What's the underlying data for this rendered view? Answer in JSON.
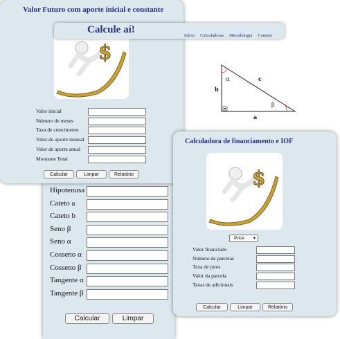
{
  "trig_panel": {
    "labels": [
      "Hipotenusa",
      "Cateto a",
      "Cateto b",
      "Seno β",
      "Seno α",
      "Cosseno α",
      "Cosseno β",
      "Tangente α",
      "Tangente β"
    ],
    "calc_button": "Calcular",
    "clear_button": "Limpar"
  },
  "future_panel": {
    "title": "Valor Futuro com aporte inicial e constante",
    "fields": [
      "Valor inicial",
      "Número de meses",
      "Taxa de crescimento",
      "Valor do aporte mensal",
      "Valor de aporte anual",
      "Montante Total"
    ],
    "calc_button": "Calcular",
    "clear_button": "Limpar",
    "report_button": "Relatório"
  },
  "header": {
    "brand": "Calcule aí!",
    "nav": [
      "Início",
      "Calculadoras",
      "Metodologia",
      "Contato"
    ]
  },
  "triangle": {
    "side_a": "a",
    "side_b": "b",
    "side_c": "c",
    "angle_alpha": "α",
    "angle_beta": "β"
  },
  "finance_panel": {
    "title": "Calculadora de financiamento e IOF",
    "method_select": "Price",
    "fields": [
      "Valor financiado",
      "Número de parcelas",
      "Taxa de juros",
      "Valor da parcela",
      "Taxas de adicionais"
    ],
    "calc_button": "Calcular",
    "clear_button": "Limpar",
    "report_button": "Relatório"
  },
  "colors": {
    "panel_bg": "#dde7ee",
    "title": "#23307a",
    "angle_mark": "#d0302a",
    "gold": "#c8a13a"
  }
}
